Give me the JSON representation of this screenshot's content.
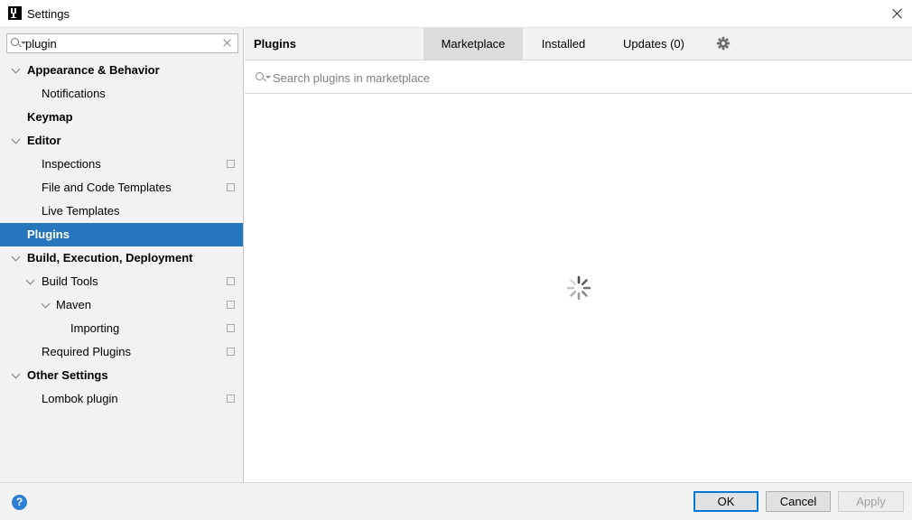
{
  "window": {
    "title": "Settings"
  },
  "sidebar": {
    "search": {
      "value": "plugin"
    },
    "items": [
      {
        "label": "Appearance & Behavior"
      },
      {
        "label": "Notifications"
      },
      {
        "label": "Keymap"
      },
      {
        "label": "Editor"
      },
      {
        "label": "Inspections"
      },
      {
        "label": "File and Code Templates"
      },
      {
        "label": "Live Templates"
      },
      {
        "label": "Plugins"
      },
      {
        "label": "Build, Execution, Deployment"
      },
      {
        "label": "Build Tools"
      },
      {
        "label": "Maven"
      },
      {
        "label": "Importing"
      },
      {
        "label": "Required Plugins"
      },
      {
        "label": "Other Settings"
      },
      {
        "label": "Lombok plugin"
      }
    ],
    "selected": "Plugins"
  },
  "header": {
    "title": "Plugins",
    "tabs": [
      {
        "label": "Marketplace"
      },
      {
        "label": "Installed"
      },
      {
        "label": "Updates (0)"
      }
    ],
    "active_tab": "Marketplace"
  },
  "marketplace": {
    "search_placeholder": "Search plugins in marketplace",
    "loading": true
  },
  "footer": {
    "help_icon": "?",
    "ok_label": "OK",
    "cancel_label": "Cancel",
    "apply_label": "Apply"
  },
  "colors": {
    "selection": "#2675bf",
    "panel": "#f2f2f2",
    "help": "#2f7fd4"
  }
}
